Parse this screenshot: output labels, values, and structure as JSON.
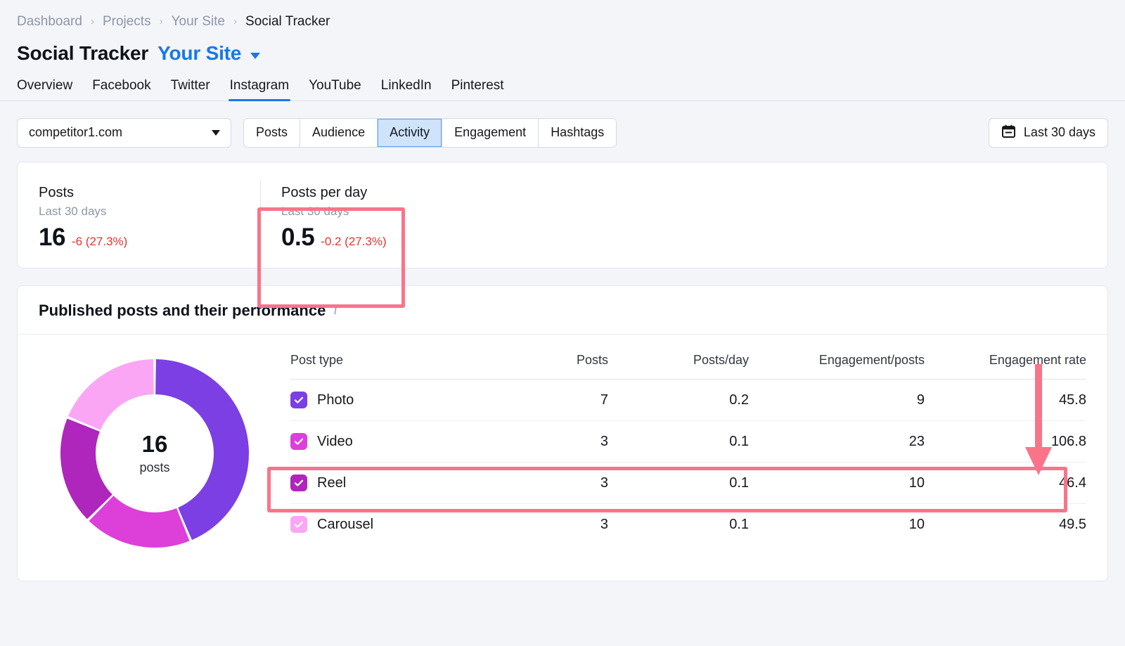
{
  "breadcrumb": {
    "items": [
      {
        "label": "Dashboard",
        "current": false
      },
      {
        "label": "Projects",
        "current": false
      },
      {
        "label": "Your Site",
        "current": false
      },
      {
        "label": "Social Tracker",
        "current": true
      }
    ],
    "separator": "›"
  },
  "header": {
    "title": "Social Tracker",
    "site": "Your Site",
    "caret_icon": "chevron-down-icon"
  },
  "channel_tabs": [
    {
      "label": "Overview",
      "active": false
    },
    {
      "label": "Facebook",
      "active": false
    },
    {
      "label": "Twitter",
      "active": false
    },
    {
      "label": "Instagram",
      "active": true
    },
    {
      "label": "YouTube",
      "active": false
    },
    {
      "label": "LinkedIn",
      "active": false
    },
    {
      "label": "Pinterest",
      "active": false
    }
  ],
  "toolbar": {
    "domain_value": "competitor1.com",
    "domain_caret_icon": "chevron-down-icon",
    "segments": [
      {
        "label": "Posts",
        "active": false
      },
      {
        "label": "Audience",
        "active": false
      },
      {
        "label": "Activity",
        "active": true
      },
      {
        "label": "Engagement",
        "active": false
      },
      {
        "label": "Hashtags",
        "active": false
      }
    ],
    "date_range": "Last 30 days",
    "calendar_icon": "calendar-icon"
  },
  "kpis": [
    {
      "label": "Posts",
      "period": "Last 30 days",
      "value": "16",
      "delta": "-6 (27.3%)",
      "highlighted": false
    },
    {
      "label": "Posts per day",
      "period": "Last 30 days",
      "value": "0.5",
      "delta": "-0.2 (27.3%)",
      "highlighted": true
    }
  ],
  "performance": {
    "title": "Published posts and their performance",
    "info_icon": "info-icon",
    "donut": {
      "center_value": "16",
      "center_label": "posts"
    },
    "columns": [
      {
        "key": "type",
        "label": "Post type"
      },
      {
        "key": "posts",
        "label": "Posts"
      },
      {
        "key": "perday",
        "label": "Posts/day"
      },
      {
        "key": "engpost",
        "label": "Engagement/posts"
      },
      {
        "key": "engrate",
        "label": "Engagement rate"
      }
    ],
    "rows": [
      {
        "type": "Photo",
        "posts": "7",
        "perday": "0.2",
        "engpost": "9",
        "engrate": "45.8",
        "color": "#7b3fe4",
        "checked": true,
        "highlighted": false
      },
      {
        "type": "Video",
        "posts": "3",
        "perday": "0.1",
        "engpost": "23",
        "engrate": "106.8",
        "color": "#dd3fd9",
        "checked": true,
        "highlighted": true
      },
      {
        "type": "Reel",
        "posts": "3",
        "perday": "0.1",
        "engpost": "10",
        "engrate": "46.4",
        "color": "#ae26bc",
        "checked": true,
        "highlighted": false
      },
      {
        "type": "Carousel",
        "posts": "3",
        "perday": "0.1",
        "engpost": "10",
        "engrate": "49.5",
        "color": "#fba6f5",
        "checked": true,
        "highlighted": false
      }
    ]
  },
  "chart_data": {
    "type": "pie",
    "title": "Published posts and their performance",
    "subtype": "donut",
    "total": 16,
    "total_label": "posts",
    "categories": [
      "Photo",
      "Video",
      "Reel",
      "Carousel"
    ],
    "values": [
      7,
      3,
      3,
      3
    ],
    "colors": [
      "#7b3fe4",
      "#dd3fd9",
      "#ae26bc",
      "#fba6f5"
    ],
    "legend": "table",
    "table": {
      "columns": [
        "Post type",
        "Posts",
        "Posts/day",
        "Engagement/posts",
        "Engagement rate"
      ],
      "rows": [
        [
          "Photo",
          7,
          0.2,
          9,
          45.8
        ],
        [
          "Video",
          3,
          0.1,
          23,
          106.8
        ],
        [
          "Reel",
          3,
          0.1,
          10,
          46.4
        ],
        [
          "Carousel",
          3,
          0.1,
          10,
          49.5
        ]
      ]
    }
  },
  "annotations": {
    "color": "#fa7489",
    "highlight_boxes": [
      "posts-per-day-kpi",
      "video-table-row"
    ],
    "arrow": {
      "points_to": "video-engagement-rate",
      "direction": "down"
    }
  }
}
